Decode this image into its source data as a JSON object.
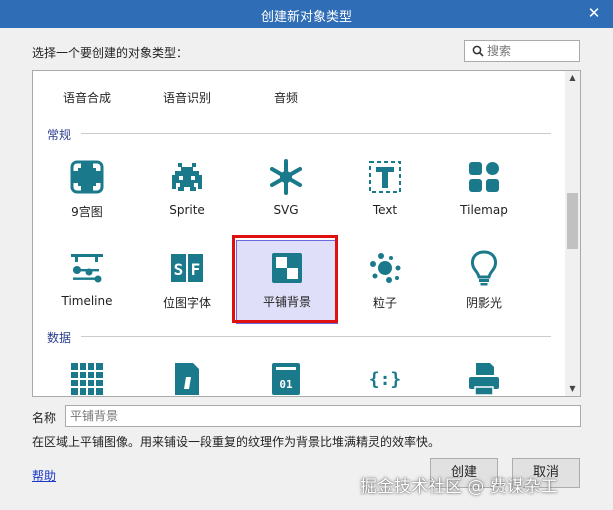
{
  "dialog": {
    "title": "创建新对象类型",
    "close_glyph": "✕"
  },
  "prompt": "选择一个要创建的对象类型：",
  "search": {
    "placeholder": "搜索",
    "value": ""
  },
  "partial_row": {
    "items": [
      {
        "label": "语音合成",
        "icon": "speech-synthesis-icon"
      },
      {
        "label": "语音识别",
        "icon": "speech-recognition-icon"
      },
      {
        "label": "音频",
        "icon": "audio-icon"
      }
    ]
  },
  "sections": {
    "general": {
      "label": "常规",
      "items": [
        {
          "label": "9宫图",
          "icon": "nine-patch-icon"
        },
        {
          "label": "Sprite",
          "icon": "sprite-invader-icon"
        },
        {
          "label": "SVG",
          "icon": "svg-asterisk-icon"
        },
        {
          "label": "Text",
          "icon": "text-icon"
        },
        {
          "label": "Tilemap",
          "icon": "tilemap-icon"
        },
        {
          "label": "Timeline",
          "icon": "timeline-icon"
        },
        {
          "label": "位图字体",
          "icon": "bitmap-font-icon"
        },
        {
          "label": "平铺背景",
          "icon": "tiled-background-icon",
          "selected": true
        },
        {
          "label": "粒子",
          "icon": "particles-icon"
        },
        {
          "label": "阴影光",
          "icon": "shadow-light-icon"
        }
      ]
    },
    "data": {
      "label": "数据",
      "items": [
        {
          "label": "",
          "icon": "array-grid-icon"
        },
        {
          "label": "",
          "icon": "csv-file-icon"
        },
        {
          "label": "",
          "icon": "binary-data-icon"
        },
        {
          "label": "",
          "icon": "json-braces-icon"
        },
        {
          "label": "",
          "icon": "printer-icon"
        }
      ]
    }
  },
  "name_field": {
    "label": "名称",
    "placeholder": "平铺背景"
  },
  "description": "在区域上平铺图像。用来铺设一段重复的纹理作为背景比堆满精灵的效率快。",
  "help_link": "帮助",
  "buttons": {
    "create": "创建",
    "cancel": "取消"
  },
  "watermark": "掘金技术社区 @ 费谋杂工",
  "colors": {
    "accent": "#1a7a8c",
    "title_bar": "#2f6db6",
    "selection_border": "#e01010",
    "section_label": "#2a3d8f"
  }
}
